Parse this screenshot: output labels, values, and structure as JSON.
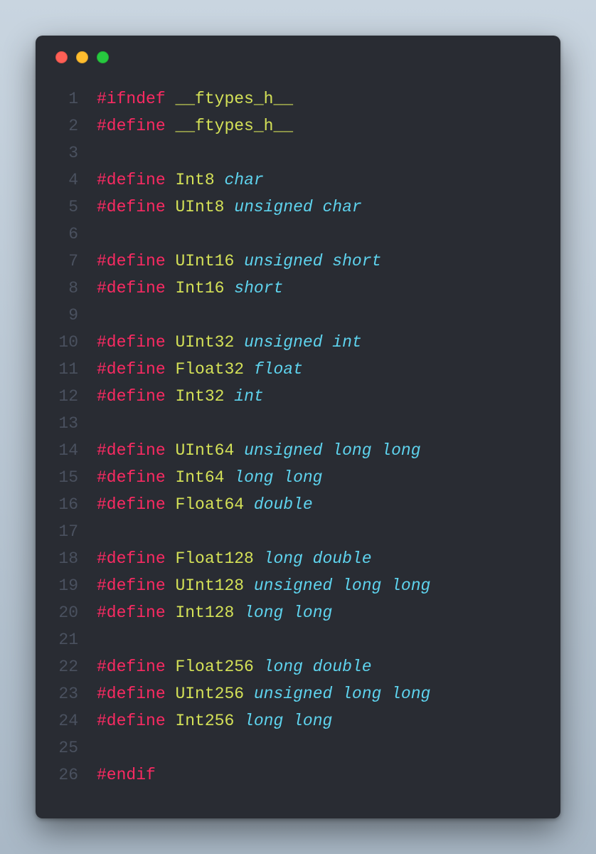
{
  "window": {
    "traffic_lights": [
      "close",
      "minimize",
      "zoom"
    ]
  },
  "colors": {
    "background": "#292c33",
    "line_number": "#4a515f",
    "directive": "#f92a62",
    "identifier": "#d4e157",
    "type": "#5ed3ee"
  },
  "code": {
    "lines": [
      {
        "n": 1,
        "tokens": [
          {
            "t": "#ifndef",
            "c": "dir"
          },
          {
            "t": " ",
            "c": null
          },
          {
            "t": "__ftypes_h__",
            "c": "ident"
          }
        ]
      },
      {
        "n": 2,
        "tokens": [
          {
            "t": "#define",
            "c": "dir"
          },
          {
            "t": " ",
            "c": null
          },
          {
            "t": "__ftypes_h__",
            "c": "ident"
          }
        ]
      },
      {
        "n": 3,
        "tokens": []
      },
      {
        "n": 4,
        "tokens": [
          {
            "t": "#define",
            "c": "dir"
          },
          {
            "t": " ",
            "c": null
          },
          {
            "t": "Int8",
            "c": "ident"
          },
          {
            "t": " ",
            "c": null
          },
          {
            "t": "char",
            "c": "type"
          }
        ]
      },
      {
        "n": 5,
        "tokens": [
          {
            "t": "#define",
            "c": "dir"
          },
          {
            "t": " ",
            "c": null
          },
          {
            "t": "UInt8",
            "c": "ident"
          },
          {
            "t": " ",
            "c": null
          },
          {
            "t": "unsigned char",
            "c": "type"
          }
        ]
      },
      {
        "n": 6,
        "tokens": []
      },
      {
        "n": 7,
        "tokens": [
          {
            "t": "#define",
            "c": "dir"
          },
          {
            "t": " ",
            "c": null
          },
          {
            "t": "UInt16",
            "c": "ident"
          },
          {
            "t": " ",
            "c": null
          },
          {
            "t": "unsigned short",
            "c": "type"
          }
        ]
      },
      {
        "n": 8,
        "tokens": [
          {
            "t": "#define",
            "c": "dir"
          },
          {
            "t": " ",
            "c": null
          },
          {
            "t": "Int16",
            "c": "ident"
          },
          {
            "t": " ",
            "c": null
          },
          {
            "t": "short",
            "c": "type"
          }
        ]
      },
      {
        "n": 9,
        "tokens": []
      },
      {
        "n": 10,
        "tokens": [
          {
            "t": "#define",
            "c": "dir"
          },
          {
            "t": " ",
            "c": null
          },
          {
            "t": "UInt32",
            "c": "ident"
          },
          {
            "t": " ",
            "c": null
          },
          {
            "t": "unsigned int",
            "c": "type"
          }
        ]
      },
      {
        "n": 11,
        "tokens": [
          {
            "t": "#define",
            "c": "dir"
          },
          {
            "t": " ",
            "c": null
          },
          {
            "t": "Float32",
            "c": "ident"
          },
          {
            "t": " ",
            "c": null
          },
          {
            "t": "float",
            "c": "type"
          }
        ]
      },
      {
        "n": 12,
        "tokens": [
          {
            "t": "#define",
            "c": "dir"
          },
          {
            "t": " ",
            "c": null
          },
          {
            "t": "Int32",
            "c": "ident"
          },
          {
            "t": " ",
            "c": null
          },
          {
            "t": "int",
            "c": "type"
          }
        ]
      },
      {
        "n": 13,
        "tokens": []
      },
      {
        "n": 14,
        "tokens": [
          {
            "t": "#define",
            "c": "dir"
          },
          {
            "t": " ",
            "c": null
          },
          {
            "t": "UInt64",
            "c": "ident"
          },
          {
            "t": " ",
            "c": null
          },
          {
            "t": "unsigned long long",
            "c": "type"
          }
        ]
      },
      {
        "n": 15,
        "tokens": [
          {
            "t": "#define",
            "c": "dir"
          },
          {
            "t": " ",
            "c": null
          },
          {
            "t": "Int64",
            "c": "ident"
          },
          {
            "t": " ",
            "c": null
          },
          {
            "t": "long long",
            "c": "type"
          }
        ]
      },
      {
        "n": 16,
        "tokens": [
          {
            "t": "#define",
            "c": "dir"
          },
          {
            "t": " ",
            "c": null
          },
          {
            "t": "Float64",
            "c": "ident"
          },
          {
            "t": " ",
            "c": null
          },
          {
            "t": "double",
            "c": "type"
          }
        ]
      },
      {
        "n": 17,
        "tokens": []
      },
      {
        "n": 18,
        "tokens": [
          {
            "t": "#define",
            "c": "dir"
          },
          {
            "t": " ",
            "c": null
          },
          {
            "t": "Float128",
            "c": "ident"
          },
          {
            "t": " ",
            "c": null
          },
          {
            "t": "long double",
            "c": "type"
          }
        ]
      },
      {
        "n": 19,
        "tokens": [
          {
            "t": "#define",
            "c": "dir"
          },
          {
            "t": " ",
            "c": null
          },
          {
            "t": "UInt128",
            "c": "ident"
          },
          {
            "t": " ",
            "c": null
          },
          {
            "t": "unsigned long long",
            "c": "type"
          }
        ]
      },
      {
        "n": 20,
        "tokens": [
          {
            "t": "#define",
            "c": "dir"
          },
          {
            "t": " ",
            "c": null
          },
          {
            "t": "Int128",
            "c": "ident"
          },
          {
            "t": " ",
            "c": null
          },
          {
            "t": "long long",
            "c": "type"
          }
        ]
      },
      {
        "n": 21,
        "tokens": []
      },
      {
        "n": 22,
        "tokens": [
          {
            "t": "#define",
            "c": "dir"
          },
          {
            "t": " ",
            "c": null
          },
          {
            "t": "Float256",
            "c": "ident"
          },
          {
            "t": " ",
            "c": null
          },
          {
            "t": "long double",
            "c": "type"
          }
        ]
      },
      {
        "n": 23,
        "tokens": [
          {
            "t": "#define",
            "c": "dir"
          },
          {
            "t": " ",
            "c": null
          },
          {
            "t": "UInt256",
            "c": "ident"
          },
          {
            "t": " ",
            "c": null
          },
          {
            "t": "unsigned long long",
            "c": "type"
          }
        ]
      },
      {
        "n": 24,
        "tokens": [
          {
            "t": "#define",
            "c": "dir"
          },
          {
            "t": " ",
            "c": null
          },
          {
            "t": "Int256",
            "c": "ident"
          },
          {
            "t": " ",
            "c": null
          },
          {
            "t": "long long",
            "c": "type"
          }
        ]
      },
      {
        "n": 25,
        "tokens": []
      },
      {
        "n": 26,
        "tokens": [
          {
            "t": "#endif",
            "c": "dir"
          }
        ]
      }
    ]
  }
}
